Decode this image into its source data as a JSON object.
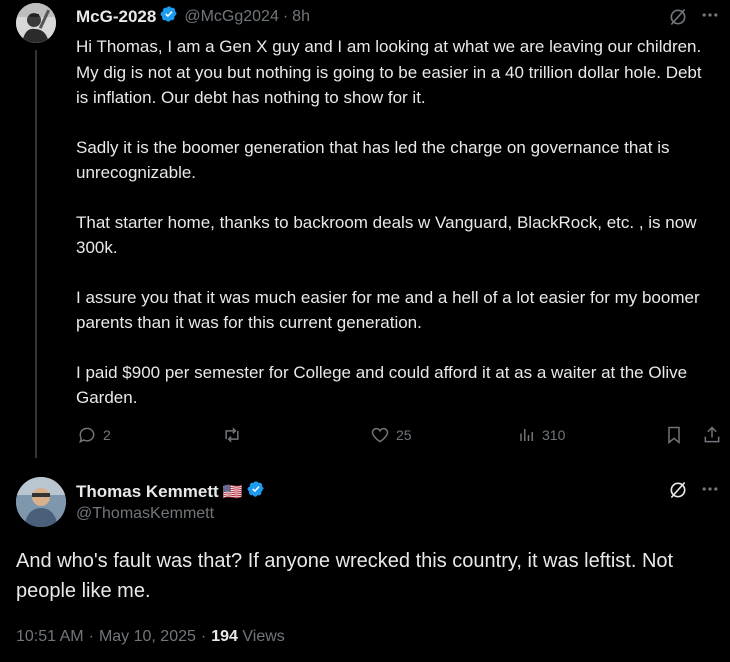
{
  "tweet1": {
    "display_name": "McG-2028",
    "handle": "@McGg2024",
    "separator": "·",
    "time": "8h",
    "paragraphs": [
      "Hi Thomas, I am a Gen X guy and I am looking at what we are leaving our children. My dig is not at you but nothing is going to be easier in a 40 trillion dollar hole. Debt is inflation. Our debt has nothing to show for it.",
      "Sadly it is the boomer generation that has led the charge on governance that is unrecognizable.",
      "That starter home, thanks to backroom deals w Vanguard, BlackRock, etc. , is now 300k.",
      "I assure you that it was much easier for me and a hell of a lot easier for my boomer parents than it was for this current generation.",
      "I paid $900 per semester for College and could afford it at as a waiter at the Olive Garden."
    ],
    "replies": "2",
    "likes": "25",
    "views": "310"
  },
  "tweet2": {
    "display_name": "Thomas Kemmett",
    "flag": "🇺🇸",
    "handle": "@ThomasKemmett",
    "text": "And who's fault was that? If anyone wrecked this country, it was leftist. Not people like me.",
    "time": "10:51 AM",
    "date": "May 10, 2025",
    "separator": "·",
    "views_count": "194",
    "views_label": "Views"
  },
  "icons": {
    "reply": "reply-icon",
    "retweet": "retweet-icon",
    "like": "heart-icon",
    "views": "views-icon",
    "bookmark": "bookmark-icon",
    "share": "share-icon",
    "grok": "grok-icon",
    "more": "more-icon",
    "verified": "verified-badge-icon"
  },
  "colors": {
    "background": "#000000",
    "text": "#e7e9ea",
    "muted": "#71767b",
    "verified": "#1d9bf0"
  }
}
